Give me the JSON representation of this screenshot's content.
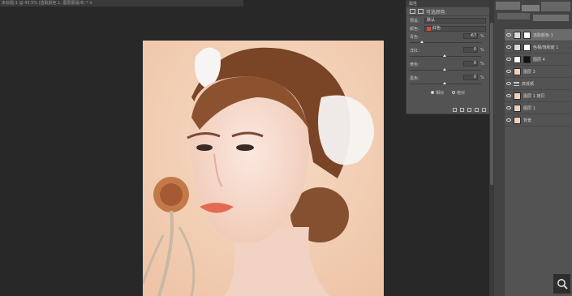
{
  "document": {
    "tab_title": "未标题-1 @ 43.5% (选取颜色 1, 图层蒙版/8) * ×"
  },
  "properties": {
    "header": "属性",
    "title": "可选颜色",
    "preset_label": "预设：",
    "preset_value": "默认",
    "colors_label": "颜色：",
    "colors_value": "红色",
    "colors_swatch": "#e0473a",
    "sliders": [
      {
        "label": "青色：",
        "value": "-67",
        "unit": "%",
        "thumb": 0.17
      },
      {
        "label": "洋红：",
        "value": "0",
        "unit": "%",
        "thumb": 0.5
      },
      {
        "label": "黄色：",
        "value": "0",
        "unit": "%",
        "thumb": 0.5
      },
      {
        "label": "黑色：",
        "value": "0",
        "unit": "%",
        "thumb": 0.5
      }
    ],
    "mode_relative": "相对",
    "mode_absolute": "绝对"
  },
  "layers": [
    {
      "name": "选取颜色 1",
      "kind": "adj",
      "selected": true
    },
    {
      "name": "色相/饱和度 1",
      "kind": "adj",
      "selected": false
    },
    {
      "name": "图层 4",
      "kind": "mask",
      "selected": false
    },
    {
      "name": "图层 3",
      "kind": "photo",
      "selected": false
    },
    {
      "name": "高低频",
      "kind": "folder",
      "selected": false
    },
    {
      "name": "图层 1 拷贝",
      "kind": "photo",
      "selected": false
    },
    {
      "name": "图层 1",
      "kind": "photo",
      "selected": false
    },
    {
      "name": "背景",
      "kind": "photo",
      "selected": false
    }
  ],
  "icons": {
    "zoom": "magnifier-icon"
  }
}
